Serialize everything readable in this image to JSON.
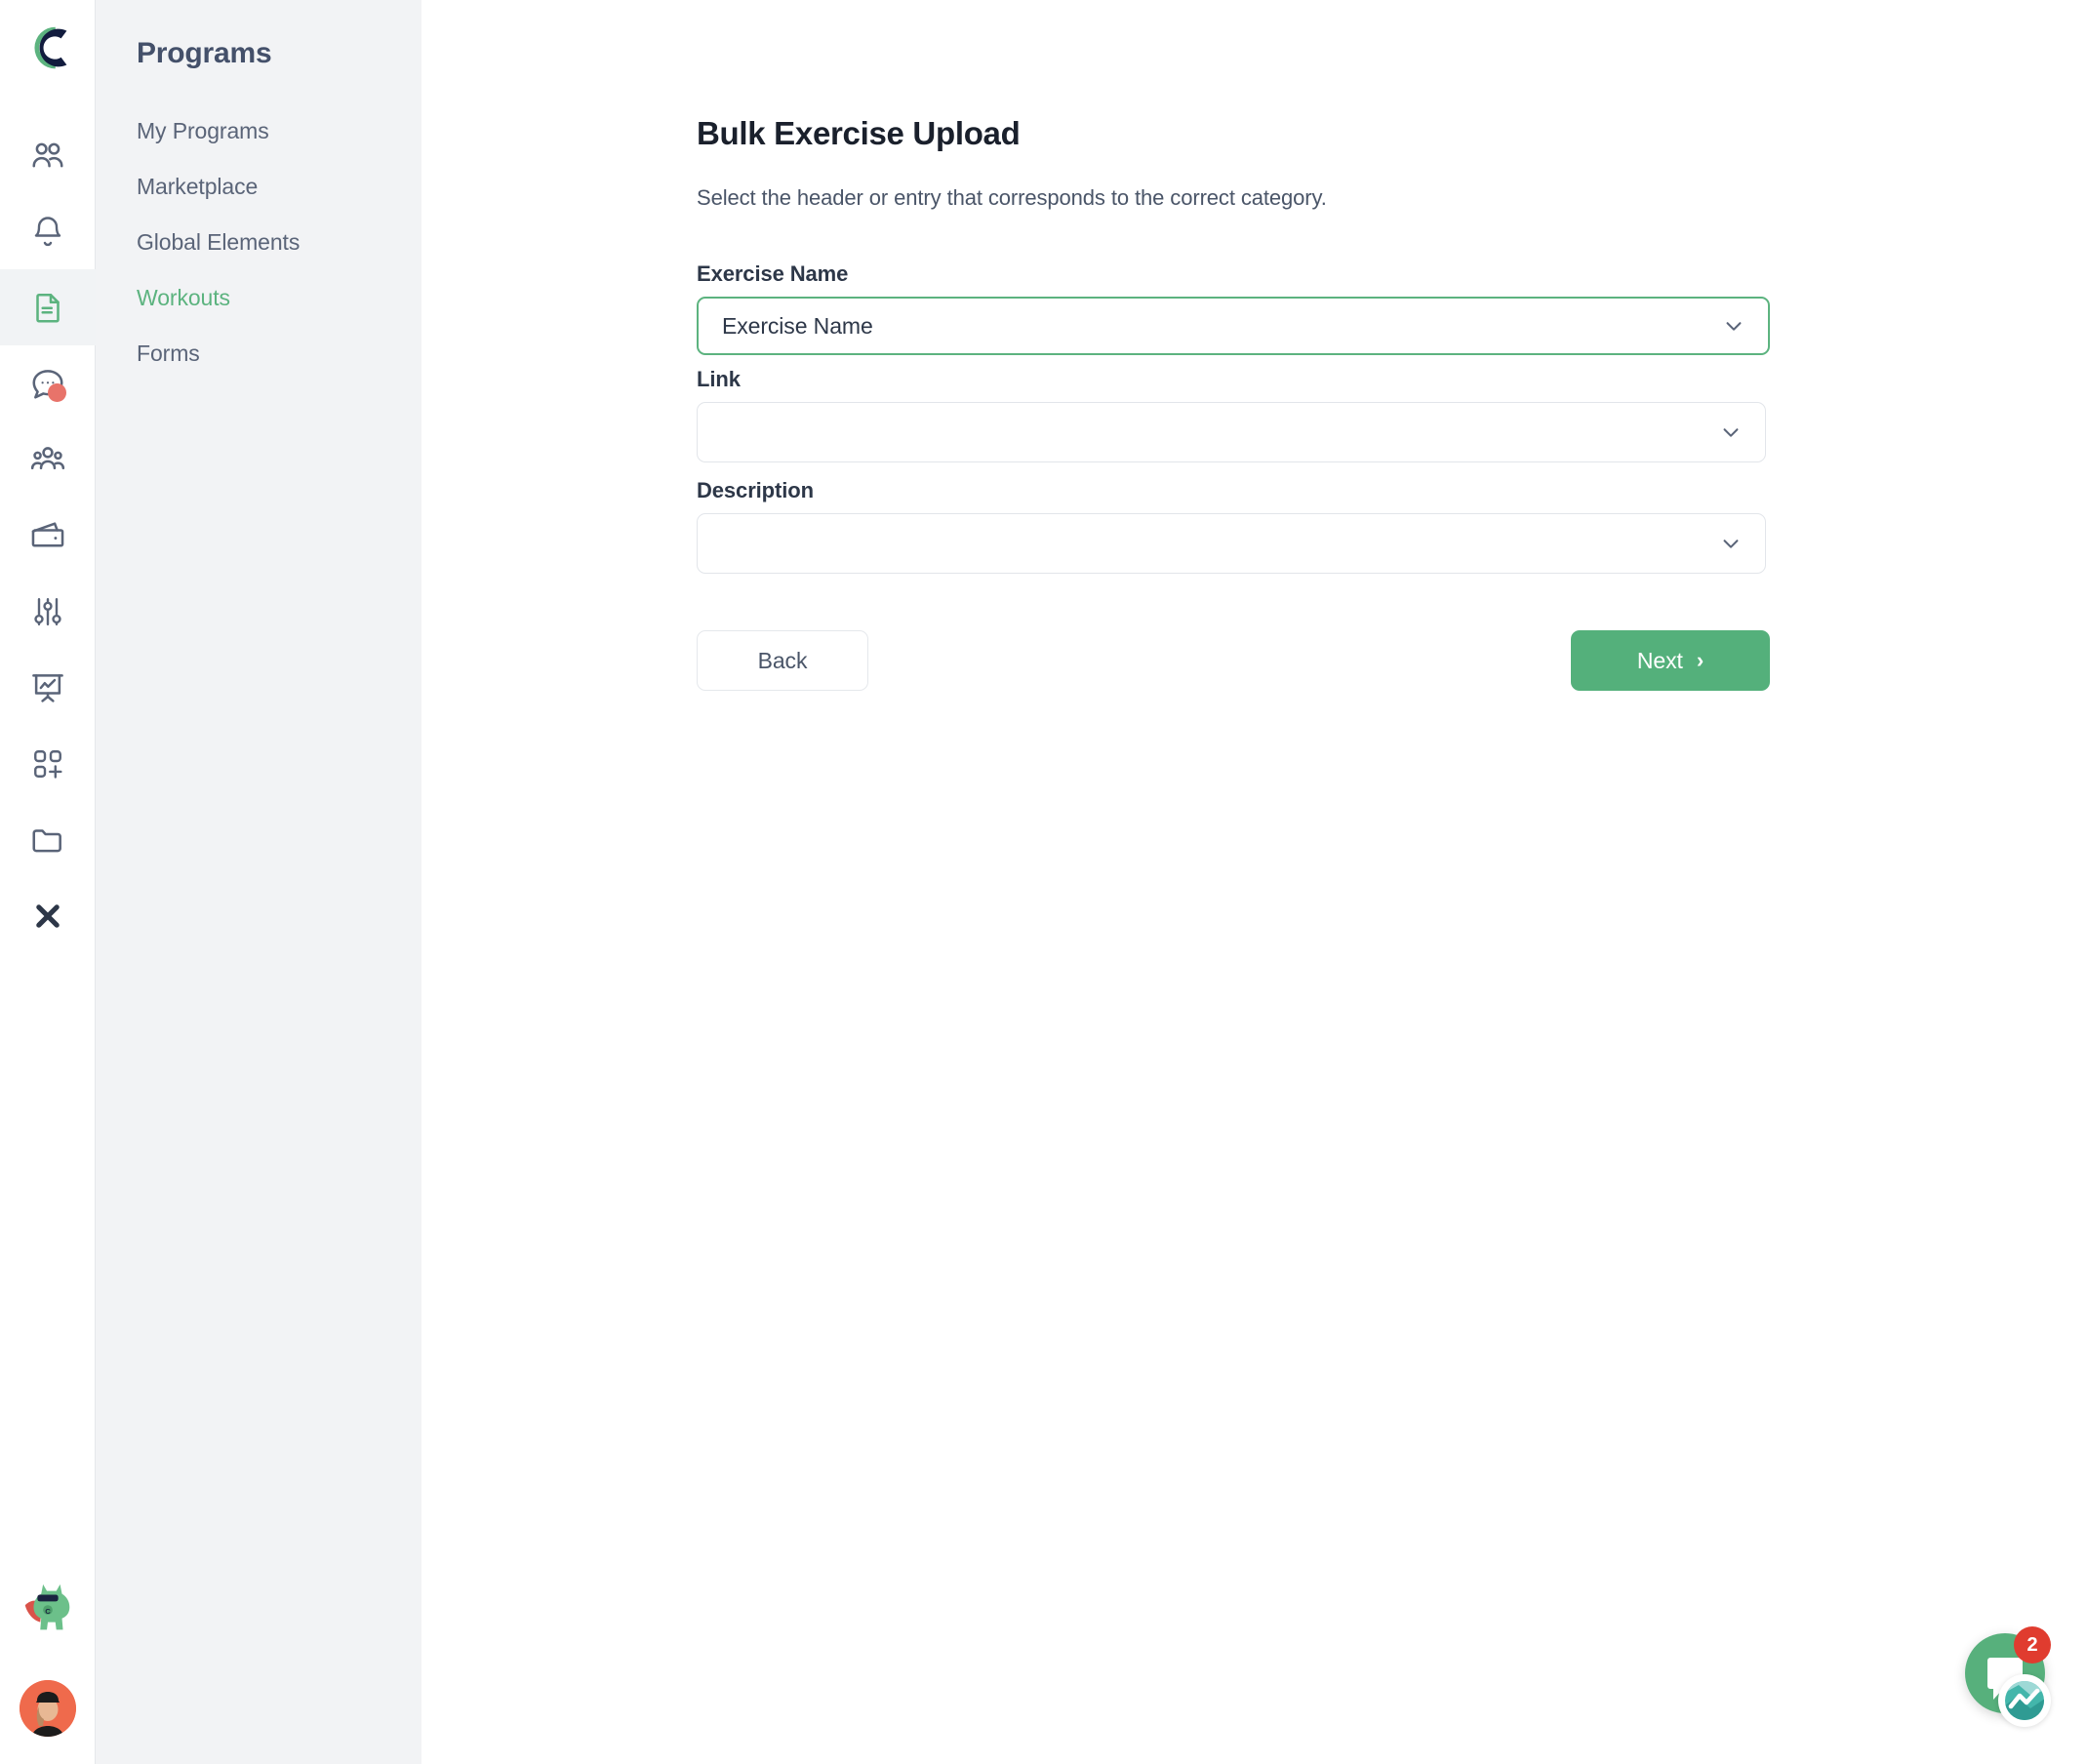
{
  "brand": {
    "logo_icon": "c-logo-icon",
    "green": "#5cb37f",
    "navy": "#121c3e",
    "accent_button": "#54b07b"
  },
  "icon_rail": {
    "items": [
      {
        "icon": "clients-icon",
        "active": false
      },
      {
        "icon": "bell-icon",
        "active": false
      },
      {
        "icon": "document-icon",
        "active": true
      },
      {
        "icon": "chat-icon",
        "active": false,
        "badge": true
      },
      {
        "icon": "group-icon",
        "active": false
      },
      {
        "icon": "wallet-icon",
        "active": false
      },
      {
        "icon": "sliders-icon",
        "active": false
      },
      {
        "icon": "presentation-chart-icon",
        "active": false
      },
      {
        "icon": "add-apps-icon",
        "active": false
      },
      {
        "icon": "folder-icon",
        "active": false
      },
      {
        "icon": "close-x-icon",
        "active": false
      }
    ],
    "mascot_icon": "superhero-cat-mascot",
    "avatar_icon": "user-avatar"
  },
  "sidebar": {
    "title": "Programs",
    "items": [
      {
        "label": "My Programs",
        "active": false
      },
      {
        "label": "Marketplace",
        "active": false
      },
      {
        "label": "Global Elements",
        "active": false
      },
      {
        "label": "Workouts",
        "active": true
      },
      {
        "label": "Forms",
        "active": false
      }
    ]
  },
  "main": {
    "title": "Bulk Exercise Upload",
    "subtitle": "Select the header or entry that corresponds to the correct category.",
    "fields": [
      {
        "label": "Exercise Name",
        "value": "Exercise Name",
        "placeholder": "",
        "focused": true
      },
      {
        "label": "Link",
        "value": "",
        "placeholder": "",
        "focused": false
      },
      {
        "label": "Description",
        "value": "",
        "placeholder": "",
        "focused": false
      }
    ],
    "buttons": {
      "back": "Back",
      "next": "Next",
      "next_chevron": "›"
    }
  },
  "chat_widget": {
    "unread_count": "2",
    "launcher_icon": "chat-bubble-icon",
    "provider_icon": "intercom-logo-icon"
  }
}
